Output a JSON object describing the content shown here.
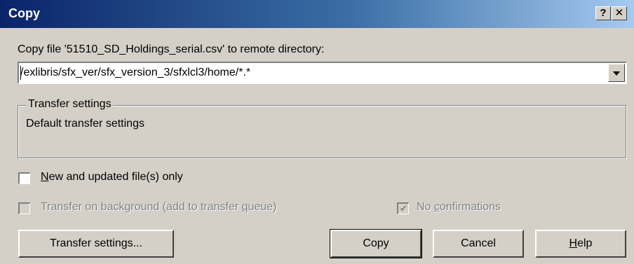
{
  "window": {
    "title": "Copy",
    "help_label": "?",
    "close_label": "✕"
  },
  "prompt": {
    "prefix": "Copy file '51510_SD_Holdings_serial.csv' to remote directory:"
  },
  "destination": {
    "value": "/exlibris/sfx_ver/sfx_version_3/sfxlcl3/home/*.*"
  },
  "transfer_settings_group": {
    "legend": "Transfer settings",
    "value": "Default transfer settings"
  },
  "options": {
    "new_updated": {
      "first": "N",
      "rest": "ew and updated file(s) only",
      "checked": false
    },
    "background": {
      "before": "Transfer on background (add to transfer ",
      "underline": "q",
      "after": "ueue)",
      "checked": false,
      "enabled": false
    },
    "no_confirmations": {
      "before": "No ",
      "underline": "c",
      "after": "onfirmations",
      "checked": true,
      "enabled": false
    }
  },
  "buttons": {
    "transfer_settings": "Transfer settings...",
    "copy": "Copy",
    "cancel": "Cancel",
    "help_first": "H",
    "help_rest": "elp"
  }
}
